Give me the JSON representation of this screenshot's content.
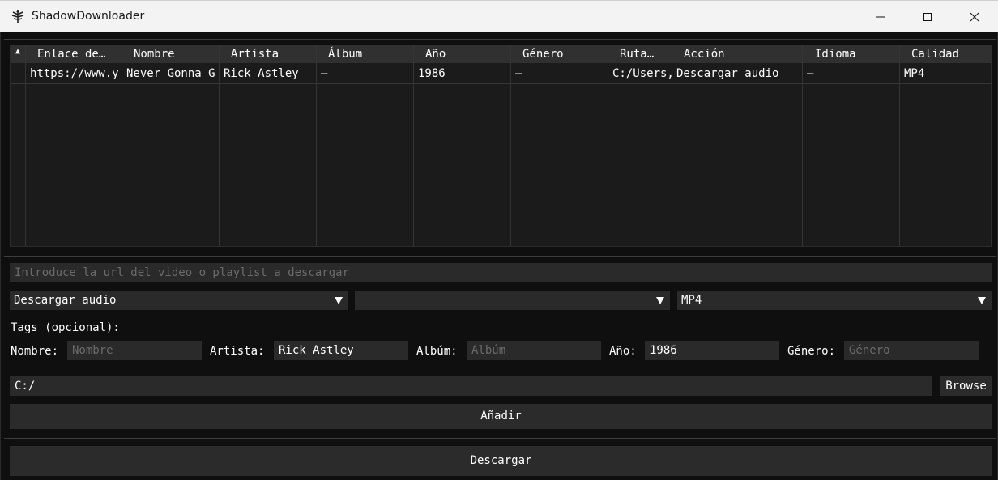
{
  "window": {
    "title": "ShadowDownloader",
    "icon": "app-logo-icon"
  },
  "table": {
    "columns": [
      "Enlace de…",
      "Nombre",
      "Artista",
      "Álbum",
      "Año",
      "Género",
      "Ruta…",
      "Acción",
      "Idioma",
      "Calidad"
    ],
    "rows": [
      [
        "https://www.y",
        "Never Gonna G",
        "Rick Astley",
        "–",
        "1986",
        "–",
        "C:/Users,",
        "Descargar audio",
        "–",
        "MP4"
      ]
    ],
    "sort_icon": "sort-ascending-icon"
  },
  "url_input": {
    "placeholder": "Introduce la url del video o playlist a descargar",
    "value": ""
  },
  "combos": {
    "action": "Descargar audio",
    "language": "",
    "quality": "MP4"
  },
  "tags": {
    "heading": "Tags (opcional):",
    "nombre_label": "Nombre:",
    "nombre_placeholder": "Nombre",
    "nombre_value": "",
    "artista_label": "Artista:",
    "artista_value": "Rick Astley",
    "album_label": "Albúm:",
    "album_placeholder": "Albúm",
    "album_value": "",
    "anio_label": "Año:",
    "anio_value": "1986",
    "genero_label": "Género:",
    "genero_placeholder": "Género",
    "genero_value": ""
  },
  "path": {
    "value": "C:/",
    "browse_label": "Browse"
  },
  "buttons": {
    "add": "Añadir",
    "download": "Descargar"
  }
}
